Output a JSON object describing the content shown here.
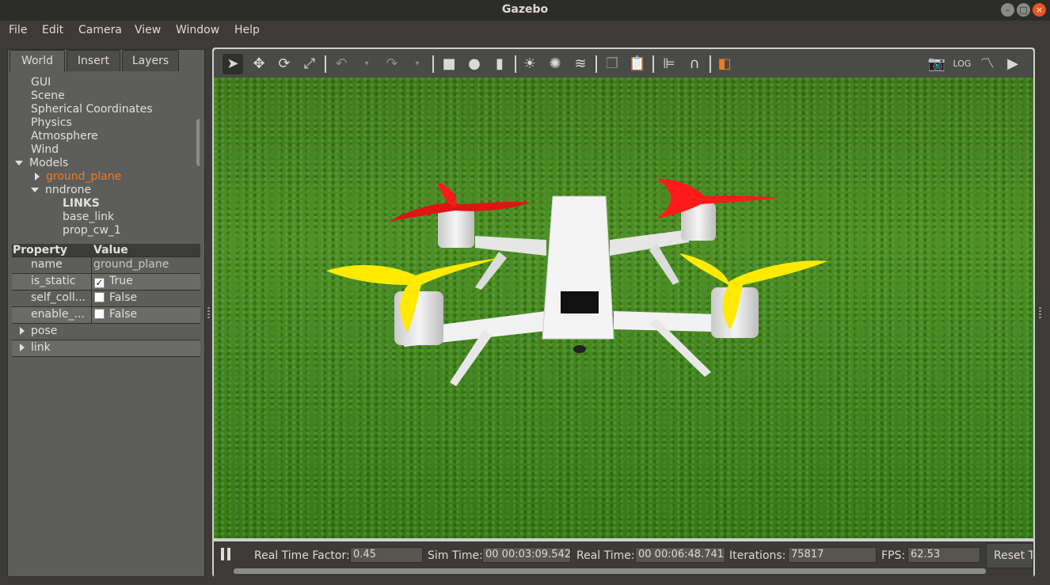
{
  "window": {
    "title": "Gazebo"
  },
  "menu": {
    "file": "File",
    "edit": "Edit",
    "camera": "Camera",
    "view": "View",
    "window": "Window",
    "help": "Help"
  },
  "tabs": {
    "world": "World",
    "insert": "Insert",
    "layers": "Layers"
  },
  "tree": {
    "gui": "GUI",
    "scene": "Scene",
    "spherical": "Spherical Coordinates",
    "physics": "Physics",
    "atmosphere": "Atmosphere",
    "wind": "Wind",
    "models": "Models",
    "ground_plane": "ground_plane",
    "nndrone": "nndrone",
    "links": "LINKS",
    "base_link": "base_link",
    "prop_cw_1": "prop_cw_1"
  },
  "properties": {
    "header_property": "Property",
    "header_value": "Value",
    "rows": [
      {
        "name": "name",
        "value": "ground_plane",
        "checkbox": null
      },
      {
        "name": "is_static",
        "value": "True",
        "checkbox": true
      },
      {
        "name": "self_coll...",
        "value": "False",
        "checkbox": false
      },
      {
        "name": "enable_...",
        "value": "False",
        "checkbox": false
      }
    ],
    "pose": "pose",
    "link": "link"
  },
  "statusbar": {
    "rtf_label": "Real Time Factor:",
    "rtf_value": "0.45",
    "sim_label": "Sim Time:",
    "sim_value": "00 00:03:09.542",
    "real_label": "Real Time:",
    "real_value": "00 00:06:48.741",
    "iter_label": "Iterations:",
    "iter_value": "75817",
    "fps_label": "FPS:",
    "fps_value": "62.53",
    "reset_label": "Reset T"
  },
  "colors": {
    "accent_orange": "#f07b1e",
    "grass": "#4d9127",
    "prop_red": "#ff1a1a",
    "prop_yellow": "#ffea00",
    "frame_white": "#f2f2f2"
  }
}
